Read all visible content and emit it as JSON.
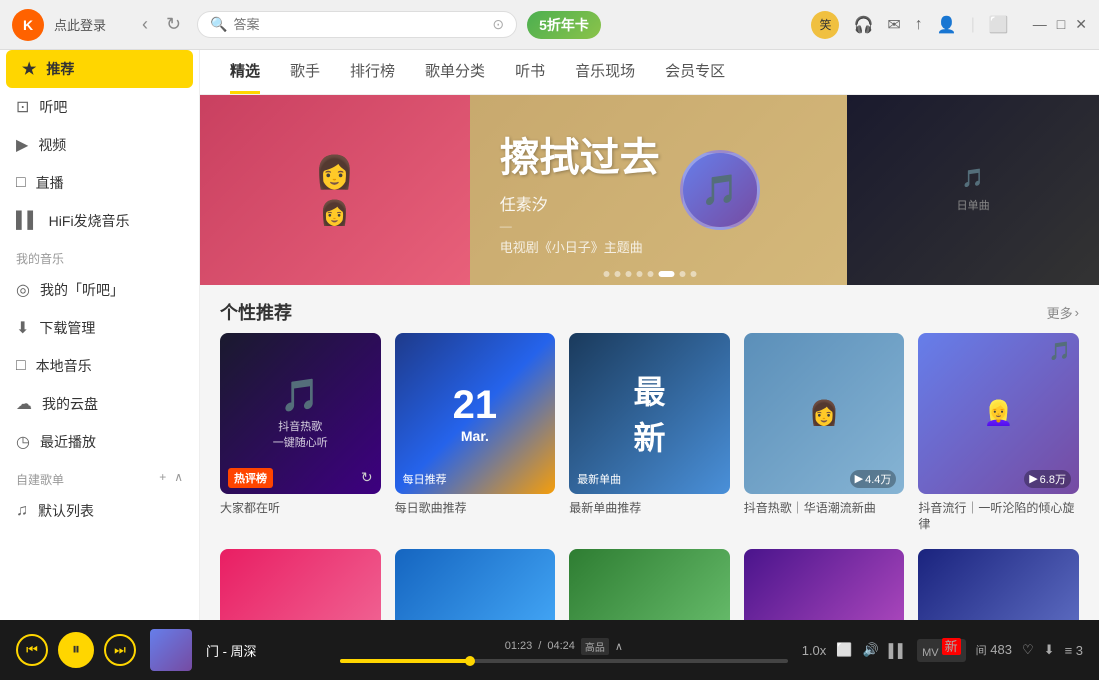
{
  "topbar": {
    "logo_text": "K",
    "login_text": "点此登录",
    "search_placeholder": "答案",
    "promo_text": "5折年卡",
    "icons": [
      "♪",
      "✉",
      "↑",
      "☺",
      "⬜"
    ],
    "window": [
      "—",
      "□",
      "✕"
    ]
  },
  "sidebar": {
    "items": [
      {
        "label": "推荐",
        "icon": "★",
        "active": true
      },
      {
        "label": "听吧",
        "icon": "⊡"
      },
      {
        "label": "视频",
        "icon": "▶"
      },
      {
        "label": "直播",
        "icon": "□"
      },
      {
        "label": "HiFi发烧音乐",
        "icon": "▌▌"
      }
    ],
    "section_title": "我的音乐",
    "my_items": [
      {
        "label": "我的「听吧」",
        "icon": "◎"
      },
      {
        "label": "下载管理",
        "icon": "⬇"
      },
      {
        "label": "本地音乐",
        "icon": "□"
      },
      {
        "label": "我的云盘",
        "icon": "☁"
      },
      {
        "label": "最近播放",
        "icon": "◷"
      }
    ],
    "playlist_title": "自建歌单",
    "playlist_items": [
      {
        "label": "默认列表",
        "icon": "♫"
      }
    ]
  },
  "nav_tabs": [
    {
      "label": "精选",
      "active": true
    },
    {
      "label": "歌手"
    },
    {
      "label": "排行榜"
    },
    {
      "label": "歌单分类"
    },
    {
      "label": "听书"
    },
    {
      "label": "音乐现场"
    },
    {
      "label": "会员专区"
    }
  ],
  "banner": {
    "title": "擦拭过去",
    "artist": "任素汐",
    "divider": "—",
    "subtitle": "电视剧《小日子》主题曲",
    "dots": 8,
    "active_dot": 6
  },
  "recommendations": {
    "title": "个性推荐",
    "more": "更多",
    "cards": [
      {
        "label": "大家都在听",
        "badge": "热评榜",
        "color": "tiktok",
        "icon": "🎵",
        "overlay_text": "抖音热歌\n一键随心听",
        "play_count": null
      },
      {
        "label": "每日歌曲推荐",
        "badge": null,
        "color": "daily",
        "icon": "21\nMar.",
        "overlay_text": "每日推荐",
        "play_count": null
      },
      {
        "label": "最新单曲推荐",
        "badge": null,
        "color": "new",
        "icon": "最\n新",
        "overlay_text": "最新单曲",
        "play_count": null
      },
      {
        "label": "抖音热歌｜华语潮流新曲",
        "badge": null,
        "color": "popular4",
        "play_count": "4.4万",
        "overlay_text": null
      },
      {
        "label": "抖音流行｜一听沦陷的倾心旋律",
        "badge": null,
        "color": "popular5",
        "play_count": "6.8万",
        "overlay_text": null
      }
    ]
  },
  "player": {
    "song": "门 - 周深",
    "current_time": "01:23",
    "total_time": "04:24",
    "quality": "高品",
    "speed": "1.0x",
    "progress_percent": 29,
    "new_badge": "新",
    "count_483": "483",
    "count_3": "3"
  }
}
